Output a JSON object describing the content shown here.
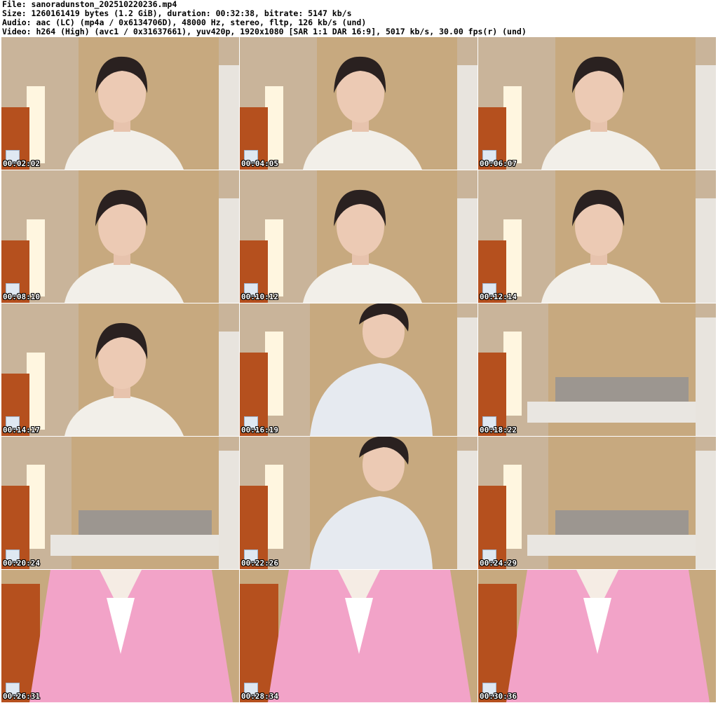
{
  "header": {
    "line1": "File: sanoradunston_202510220236.mp4",
    "line2": "Size: 1260161419 bytes (1.2 GiB), duration: 00:32:38, bitrate: 5147 kb/s",
    "line3": "Audio: aac (LC) (mp4a / 0x6134706D), 48000 Hz, stereo, fltp, 126 kb/s (und)",
    "line4": "Video: h264 (High) (avc1 / 0x31637661), yuv420p, 1920x1080 [SAR 1:1 DAR 16:9], 5017 kb/s, 30.00 fps(r) (und)"
  },
  "thumbnails": [
    {
      "time": "00:02:02",
      "scene": "person"
    },
    {
      "time": "00:04:05",
      "scene": "person"
    },
    {
      "time": "00:06:07",
      "scene": "person"
    },
    {
      "time": "00:08:10",
      "scene": "person"
    },
    {
      "time": "00:10:12",
      "scene": "person"
    },
    {
      "time": "00:12:14",
      "scene": "person"
    },
    {
      "time": "00:14:17",
      "scene": "person"
    },
    {
      "time": "00:16:19",
      "scene": "person-lean"
    },
    {
      "time": "00:18:22",
      "scene": "room"
    },
    {
      "time": "00:20:24",
      "scene": "room"
    },
    {
      "time": "00:22:26",
      "scene": "person-lean"
    },
    {
      "time": "00:24:29",
      "scene": "room"
    },
    {
      "time": "00:26:31",
      "scene": "pink-hoodie"
    },
    {
      "time": "00:28:34",
      "scene": "pink-hoodie"
    },
    {
      "time": "00:30:36",
      "scene": "pink-hoodie"
    }
  ]
}
